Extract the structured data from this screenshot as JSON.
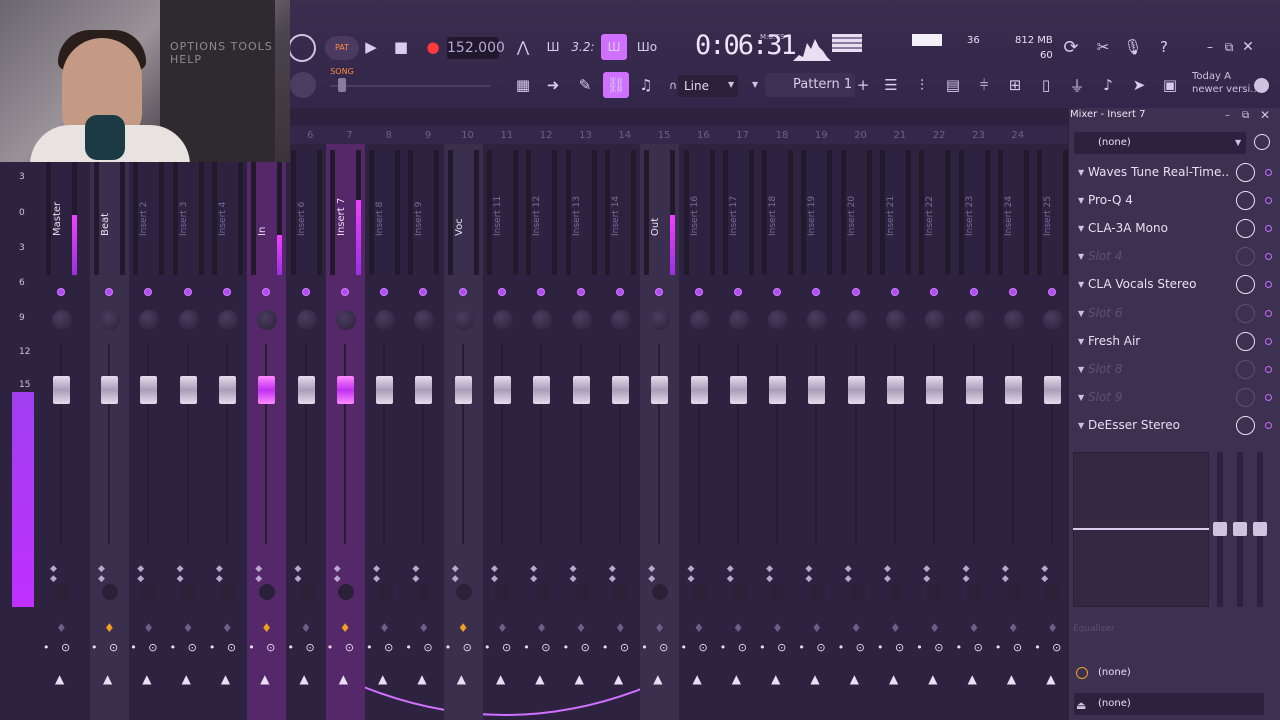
{
  "webcam": {
    "overlay_text": "OPTIONS TOOLS HELP"
  },
  "transport": {
    "pat_song": "PAT SONG",
    "bpm": "152.000",
    "step_display": "3.2:",
    "time": "0:06:31",
    "time_format": "M:S:CS",
    "cpu": "36",
    "ram": "812 MB",
    "polyphony": "60"
  },
  "toolbar2": {
    "snap": "Line",
    "pattern": "Pattern 1",
    "news_line1": "Today  A",
    "news_line2": "newer versi..."
  },
  "ruler": {
    "numbers": [
      "6",
      "7",
      "8",
      "9",
      "10",
      "11",
      "12",
      "13",
      "14",
      "15",
      "16",
      "17",
      "18",
      "19",
      "20",
      "21",
      "22",
      "23",
      "24"
    ]
  },
  "db_scale": [
    "3",
    "0",
    "3",
    "6",
    "9",
    "12",
    "15"
  ],
  "strips": [
    {
      "name": "Master"
    },
    {
      "name": "Beat"
    },
    {
      "name": "Insert 2"
    },
    {
      "name": "Insert 3"
    },
    {
      "name": "Insert 4"
    },
    {
      "name": "In"
    },
    {
      "name": "Insert 6"
    },
    {
      "name": "Insert 7"
    },
    {
      "name": "Insert 8"
    },
    {
      "name": "Insert 9"
    },
    {
      "name": "Voc"
    },
    {
      "name": "Insert 11"
    },
    {
      "name": "Insert 12"
    },
    {
      "name": "Insert 13"
    },
    {
      "name": "Insert 14"
    },
    {
      "name": "Out"
    },
    {
      "name": "Insert 16"
    },
    {
      "name": "Insert 17"
    },
    {
      "name": "Insert 18"
    },
    {
      "name": "Insert 19"
    },
    {
      "name": "Insert 20"
    },
    {
      "name": "Insert 21"
    },
    {
      "name": "Insert 22"
    },
    {
      "name": "Insert 23"
    },
    {
      "name": "Insert 24"
    },
    {
      "name": "Insert 25"
    }
  ],
  "panel": {
    "title": "Mixer - Insert 7",
    "preset": "(none)",
    "slots": [
      {
        "name": "Waves Tune Real-Time..."
      },
      {
        "name": "Pro-Q 4"
      },
      {
        "name": "CLA-3A Mono"
      },
      {
        "name": "Slot 4"
      },
      {
        "name": "CLA Vocals Stereo"
      },
      {
        "name": "Slot 6"
      },
      {
        "name": "Fresh Air"
      },
      {
        "name": "Slot 8"
      },
      {
        "name": "Slot 9"
      },
      {
        "name": "DeEsser Stereo"
      }
    ],
    "eq_label": "Equalizer",
    "in_route": "(none)",
    "out_route": "(none)"
  }
}
